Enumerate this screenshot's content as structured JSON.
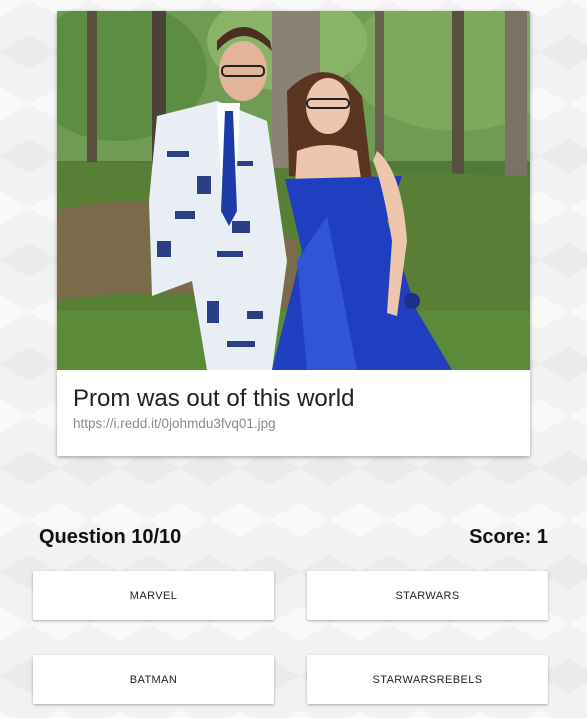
{
  "post": {
    "title": "Prom was out of this world",
    "url": "https://i.redd.it/0johmdu3fvq01.jpg",
    "image_icon": "photo"
  },
  "quiz": {
    "question_label": "Question 10/10",
    "score_label": "Score: 1"
  },
  "answers": [
    {
      "label": "MARVEL"
    },
    {
      "label": "STARWARS"
    },
    {
      "label": "BATMAN"
    },
    {
      "label": "STARWARSREBELS"
    }
  ],
  "colors": {
    "background": "#f2f2f2",
    "card": "#ffffff",
    "title_text": "#212121",
    "url_text": "#8a8a8a",
    "dress_blue": "#1f3fc0"
  }
}
